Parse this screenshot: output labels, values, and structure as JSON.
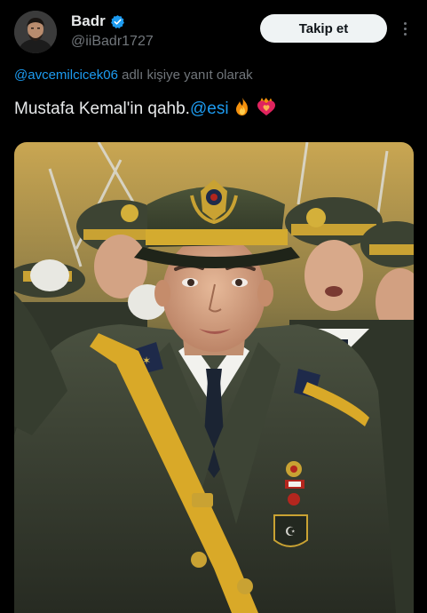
{
  "tweet": {
    "author": {
      "display_name": "Badr",
      "handle": "@iiBadr1727",
      "verified": true
    },
    "follow_label": "Takip et",
    "reply_to": {
      "mention": "@avcemilcicek06",
      "suffix": " adlı kişiye yanıt olarak"
    },
    "text_main": "Mustafa Kemal'in qahb.",
    "text_mention": "@esi",
    "emojis": [
      "fire-emoji",
      "heart-emoji"
    ],
    "media": {
      "type": "photo"
    }
  },
  "colors": {
    "background": "#000000",
    "primary_text": "#e7e9ea",
    "secondary_text": "#71767b",
    "link": "#1d9bf0",
    "verified_badge": "#1d9bf0",
    "follow_button_bg": "#eff3f4",
    "follow_button_text": "#0f1419"
  }
}
